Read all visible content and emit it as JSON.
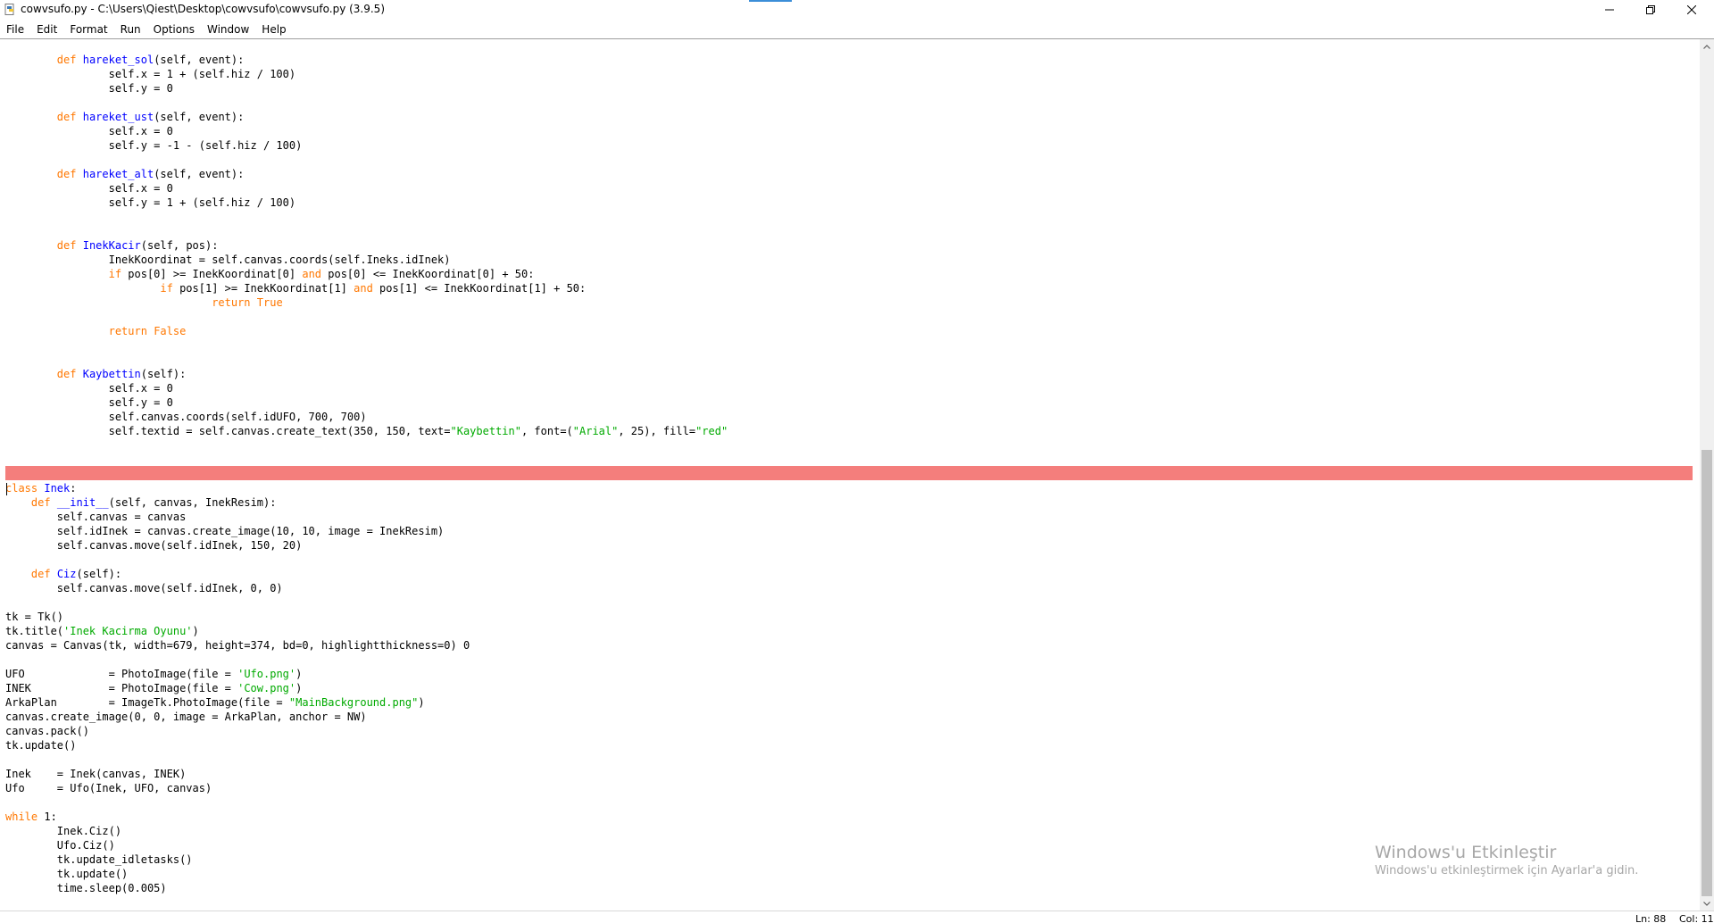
{
  "window": {
    "title": "cowvsufo.py - C:\\Users\\Qiest\\Desktop\\cowvsufo\\cowvsufo.py (3.9.5)",
    "controls": {
      "minimize_icon": "minimize-icon",
      "maximize_icon": "restore-icon",
      "close_icon": "close-icon"
    },
    "accent_color": "#3b8ed8"
  },
  "menu": [
    "File",
    "Edit",
    "Format",
    "Run",
    "Options",
    "Window",
    "Help"
  ],
  "editor": {
    "keyword_color": "#ff7700",
    "definition_color": "#0000ff",
    "string_color": "#00aa00",
    "highlight_color": "#f47e7c",
    "highlighted_line_number": 88,
    "lines": [
      [
        [
          "        ",
          ""
        ],
        [
          "def",
          "kw"
        ],
        [
          " ",
          ""
        ],
        [
          "hareket_sol",
          "def"
        ],
        [
          "(self, event):",
          ""
        ]
      ],
      [
        [
          "                self.x = 1 + (self.hiz / 100)",
          ""
        ]
      ],
      [
        [
          "                self.y = 0",
          ""
        ]
      ],
      [
        [
          "",
          ""
        ]
      ],
      [
        [
          "        ",
          ""
        ],
        [
          "def",
          "kw"
        ],
        [
          " ",
          ""
        ],
        [
          "hareket_ust",
          "def"
        ],
        [
          "(self, event):",
          ""
        ]
      ],
      [
        [
          "                self.x = 0",
          ""
        ]
      ],
      [
        [
          "                self.y = -1 - (self.hiz / 100)",
          ""
        ]
      ],
      [
        [
          "",
          ""
        ]
      ],
      [
        [
          "        ",
          ""
        ],
        [
          "def",
          "kw"
        ],
        [
          " ",
          ""
        ],
        [
          "hareket_alt",
          "def"
        ],
        [
          "(self, event):",
          ""
        ]
      ],
      [
        [
          "                self.x = 0",
          ""
        ]
      ],
      [
        [
          "                self.y = 1 + (self.hiz / 100)",
          ""
        ]
      ],
      [
        [
          "",
          ""
        ]
      ],
      [
        [
          "",
          ""
        ]
      ],
      [
        [
          "        ",
          ""
        ],
        [
          "def",
          "kw"
        ],
        [
          " ",
          ""
        ],
        [
          "InekKacir",
          "def"
        ],
        [
          "(self, pos):",
          ""
        ]
      ],
      [
        [
          "                InekKoordinat = self.canvas.coords(self.Ineks.idInek)",
          ""
        ]
      ],
      [
        [
          "                ",
          ""
        ],
        [
          "if",
          "kw"
        ],
        [
          " pos[0] >= InekKoordinat[0] ",
          ""
        ],
        [
          "and",
          "kw"
        ],
        [
          " pos[0] <= InekKoordinat[0] + 50:",
          ""
        ]
      ],
      [
        [
          "                        ",
          ""
        ],
        [
          "if",
          "kw"
        ],
        [
          " pos[1] >= InekKoordinat[1] ",
          ""
        ],
        [
          "and",
          "kw"
        ],
        [
          " pos[1] <= InekKoordinat[1] + 50:",
          ""
        ]
      ],
      [
        [
          "                                ",
          ""
        ],
        [
          "return",
          "kw"
        ],
        [
          " ",
          ""
        ],
        [
          "True",
          "kw"
        ]
      ],
      [
        [
          "",
          ""
        ]
      ],
      [
        [
          "                ",
          ""
        ],
        [
          "return",
          "kw"
        ],
        [
          " ",
          ""
        ],
        [
          "False",
          "kw"
        ]
      ],
      [
        [
          "",
          ""
        ]
      ],
      [
        [
          "",
          ""
        ]
      ],
      [
        [
          "        ",
          ""
        ],
        [
          "def",
          "kw"
        ],
        [
          " ",
          ""
        ],
        [
          "Kaybettin",
          "def"
        ],
        [
          "(self):",
          ""
        ]
      ],
      [
        [
          "                self.x = 0",
          ""
        ]
      ],
      [
        [
          "                self.y = 0",
          ""
        ]
      ],
      [
        [
          "                self.canvas.coords(self.idUFO, 700, 700)",
          ""
        ]
      ],
      [
        [
          "                self.textid = self.canvas.create_text(350, 150, text=",
          ""
        ],
        [
          "\"Kaybettin\"",
          "str"
        ],
        [
          ", font=(",
          ""
        ],
        [
          "\"Arial\"",
          "str"
        ],
        [
          ", 25), fill=",
          ""
        ],
        [
          "\"red\"",
          "str"
        ]
      ],
      [
        [
          "",
          ""
        ]
      ],
      [
        [
          "",
          ""
        ]
      ],
      [
        [
          "",
          ""
        ]
      ],
      [
        [
          "",
          ""
        ],
        [
          "class",
          "kw"
        ],
        [
          " ",
          ""
        ],
        [
          "Inek",
          "def"
        ],
        [
          ":",
          ""
        ]
      ],
      [
        [
          "    ",
          ""
        ],
        [
          "def",
          "kw"
        ],
        [
          " ",
          ""
        ],
        [
          "__init__",
          "def"
        ],
        [
          "(self, canvas, InekResim):",
          ""
        ]
      ],
      [
        [
          "        self.canvas = canvas",
          ""
        ]
      ],
      [
        [
          "        self.idInek = canvas.create_image(10, 10, image = InekResim)",
          ""
        ]
      ],
      [
        [
          "        self.canvas.move(self.idInek, 150, 20)",
          ""
        ]
      ],
      [
        [
          "",
          ""
        ]
      ],
      [
        [
          "    ",
          ""
        ],
        [
          "def",
          "kw"
        ],
        [
          " ",
          ""
        ],
        [
          "Ciz",
          "def"
        ],
        [
          "(self):",
          ""
        ]
      ],
      [
        [
          "        self.canvas.move(self.idInek, 0, 0)",
          ""
        ]
      ],
      [
        [
          "",
          ""
        ]
      ],
      [
        [
          "tk = Tk()",
          ""
        ]
      ],
      [
        [
          "tk.title(",
          ""
        ],
        [
          "'Inek Kacirma Oyunu'",
          "str"
        ],
        [
          ")",
          ""
        ]
      ],
      [
        [
          "canvas = Canvas(tk, width=679, height=374, bd=0, highlightthickness=0) 0",
          ""
        ]
      ],
      [
        [
          "",
          ""
        ]
      ],
      [
        [
          "UFO             = PhotoImage(file = ",
          ""
        ],
        [
          "'Ufo.png'",
          "str"
        ],
        [
          ")",
          ""
        ]
      ],
      [
        [
          "INEK            = PhotoImage(file = ",
          ""
        ],
        [
          "'Cow.png'",
          "str"
        ],
        [
          ")",
          ""
        ]
      ],
      [
        [
          "ArkaPlan        = ImageTk.PhotoImage(file = ",
          ""
        ],
        [
          "\"MainBackground.png\"",
          "str"
        ],
        [
          ")",
          ""
        ]
      ],
      [
        [
          "canvas.create_image(0, 0, image = ArkaPlan, anchor = NW)",
          ""
        ]
      ],
      [
        [
          "canvas.pack()",
          ""
        ]
      ],
      [
        [
          "tk.update()",
          ""
        ]
      ],
      [
        [
          "",
          ""
        ]
      ],
      [
        [
          "Inek    = Inek(canvas, INEK)",
          ""
        ]
      ],
      [
        [
          "Ufo     = Ufo(Inek, UFO, canvas)",
          ""
        ]
      ],
      [
        [
          "",
          ""
        ]
      ],
      [
        [
          "",
          ""
        ],
        [
          "while",
          "kw"
        ],
        [
          " 1:",
          ""
        ]
      ],
      [
        [
          "        Inek.Ciz()",
          ""
        ]
      ],
      [
        [
          "        Ufo.Ciz()",
          ""
        ]
      ],
      [
        [
          "        tk.update_idletasks()",
          ""
        ]
      ],
      [
        [
          "        tk.update()",
          ""
        ]
      ],
      [
        [
          "        time.sleep(0.005)",
          ""
        ]
      ]
    ]
  },
  "status": {
    "line": "Ln: 88",
    "column": "Col: 11"
  },
  "watermark": {
    "title": "Windows'u Etkinleştir",
    "subtitle": "Windows'u etkinleştirmek için Ayarlar'a gidin."
  }
}
